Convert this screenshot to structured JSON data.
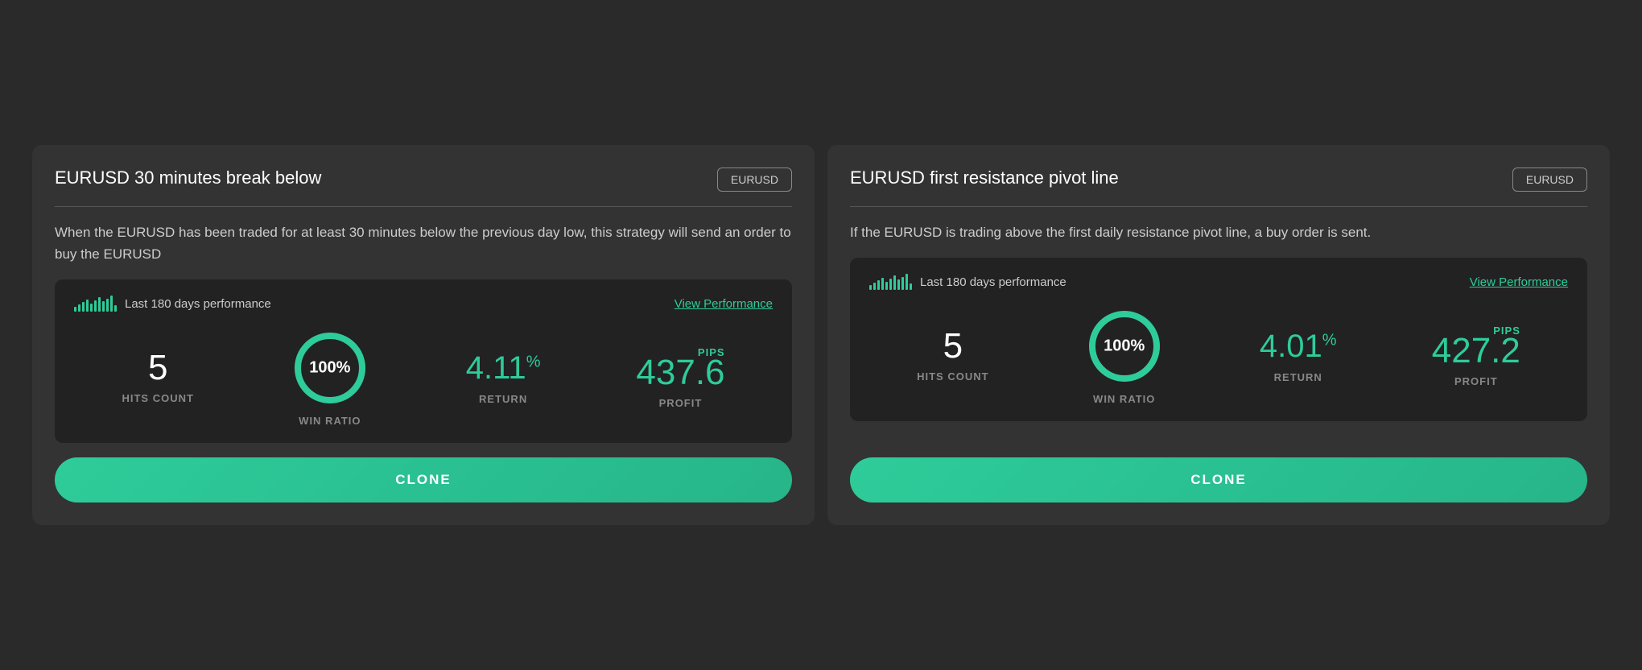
{
  "cards": [
    {
      "id": "card-1",
      "title": "EURUSD 30 minutes break below",
      "badge": "EURUSD",
      "description": "When the EURUSD has been traded for at least 30 minutes below the previous day low, this strategy will send an order to buy the EURUSD",
      "performance": {
        "label": "Last 180 days performance",
        "view_performance_label": "View Performance",
        "hits_count": "5",
        "hits_label": "HITS COUNT",
        "win_ratio": "100%",
        "win_label": "WIN RATIO",
        "win_percent": 100,
        "return": "4.11",
        "return_label": "RETURN",
        "return_symbol": "%",
        "pips_label": "PIPS",
        "profit": "437.6",
        "profit_label": "PROFIT"
      },
      "clone_label": "CLONE"
    },
    {
      "id": "card-2",
      "title": "EURUSD first resistance pivot line",
      "badge": "EURUSD",
      "description": "If the EURUSD is trading above the first daily resistance pivot line, a buy order is sent.",
      "performance": {
        "label": "Last 180 days performance",
        "view_performance_label": "View Performance",
        "hits_count": "5",
        "hits_label": "HITS COUNT",
        "win_ratio": "100%",
        "win_label": "WIN RATIO",
        "win_percent": 100,
        "return": "4.01",
        "return_label": "RETURN",
        "return_symbol": "%",
        "pips_label": "PIPS",
        "profit": "427.2",
        "profit_label": "PROFIT"
      },
      "clone_label": "CLONE"
    }
  ]
}
